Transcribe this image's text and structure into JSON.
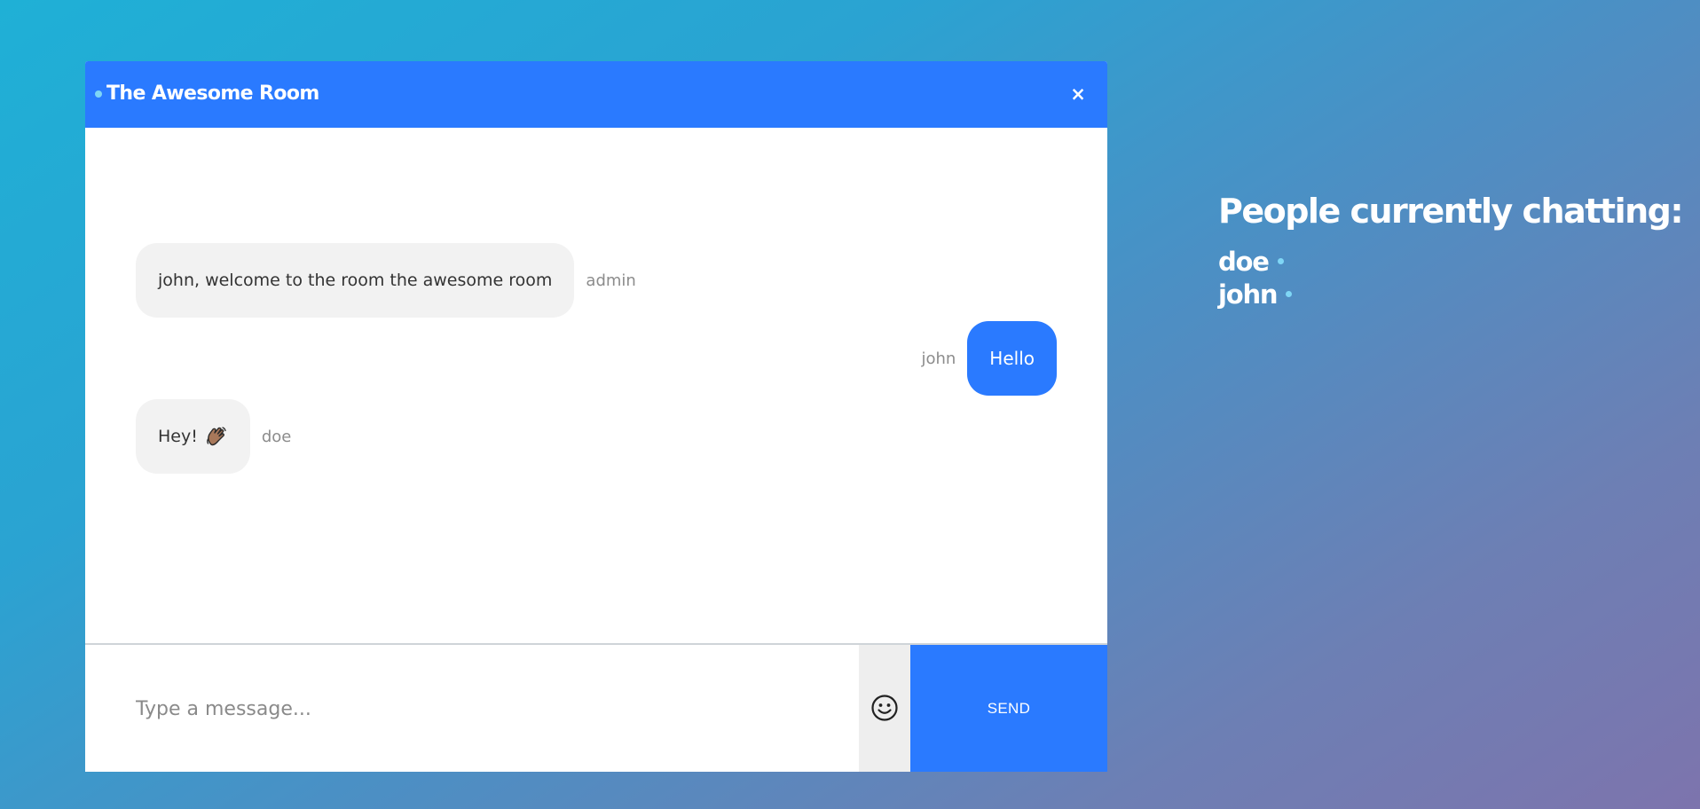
{
  "colors": {
    "header": "#2a7aff",
    "online_dot": "#7fd6f5"
  },
  "chat": {
    "room_title": "The Awesome Room",
    "close_label": "×",
    "messages": [
      {
        "text": "john, welcome to the room the awesome room",
        "sender": "admin",
        "own": false
      },
      {
        "text": "Hello",
        "sender": "john",
        "own": true
      },
      {
        "text": "Hey!",
        "sender": "doe",
        "own": false,
        "emoji": "waving-hand-icon"
      }
    ],
    "composer": {
      "placeholder": "Type a message...",
      "emoji_icon": "smiley-icon",
      "send_label": "SEND"
    }
  },
  "people": {
    "heading": "People currently chatting:",
    "list": [
      {
        "name": "doe"
      },
      {
        "name": "john"
      }
    ]
  }
}
